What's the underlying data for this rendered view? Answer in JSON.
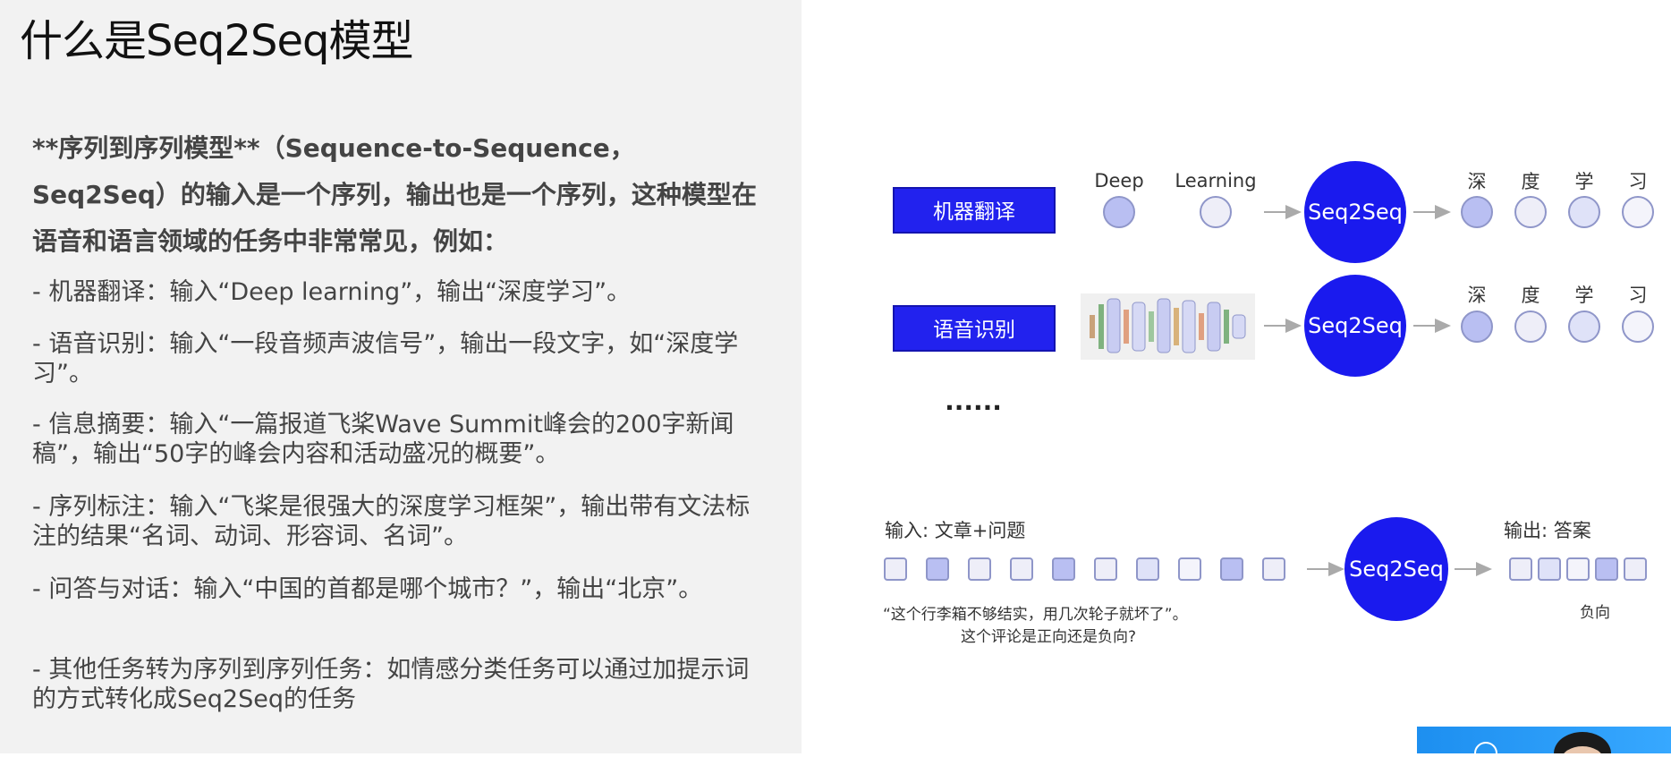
{
  "slide": {
    "title": "什么是Seq2Seq模型",
    "intro": "**序列到序列模型**（Sequence-to-Sequence，Seq2Seq）的输入是一个序列，输出也是一个序列，这种模型在语音和语言领域的任务中非常常见，例如：",
    "items": [
      "- 机器翻译：输入“Deep learning”，输出“深度学习”。",
      "- 语音识别：输入“一段音频声波信号”，输出一段文字，如“深度学习”。",
      "- 信息摘要：输入“一篇报道飞桨Wave Summit峰会的200字新闻稿”，输出“50字的峰会内容和活动盛况的概要”。",
      "- 序列标注：输入“飞桨是很强大的深度学习框架”，输出带有文法标注的结果“名词、动词、形容词、名词”。",
      "- 问答与对话：输入“中国的首都是哪个城市？”，输出“北京”。",
      "- 其他任务转为序列到序列任务：如情感分类任务可以通过加提示词的方式转化成Seq2Seq的任务"
    ]
  },
  "diagram": {
    "mt_label": "机器翻译",
    "asr_label": "语音识别",
    "ellipsis": "......",
    "model_label": "Seq2Seq",
    "input_words": [
      "Deep",
      "Learning"
    ],
    "output_chars": [
      "深",
      "度",
      "学",
      "习"
    ],
    "qa_input_label": "输入: 文章+问题",
    "qa_output_label": "输出: 答案",
    "qa_example_line1": "“这个行李箱不够结实，用几次轮子就坏了”。",
    "qa_example_line2": "这个评论是正向还是负向?",
    "qa_answer": "负向",
    "colors": {
      "label_box": "#2222ee",
      "model_circle": "#1a1aee",
      "node_filled": "#b9bff2",
      "node_light": "#eeeef8",
      "node_stroke": "#8f96c9",
      "arrow": "#aaaaaa"
    }
  }
}
